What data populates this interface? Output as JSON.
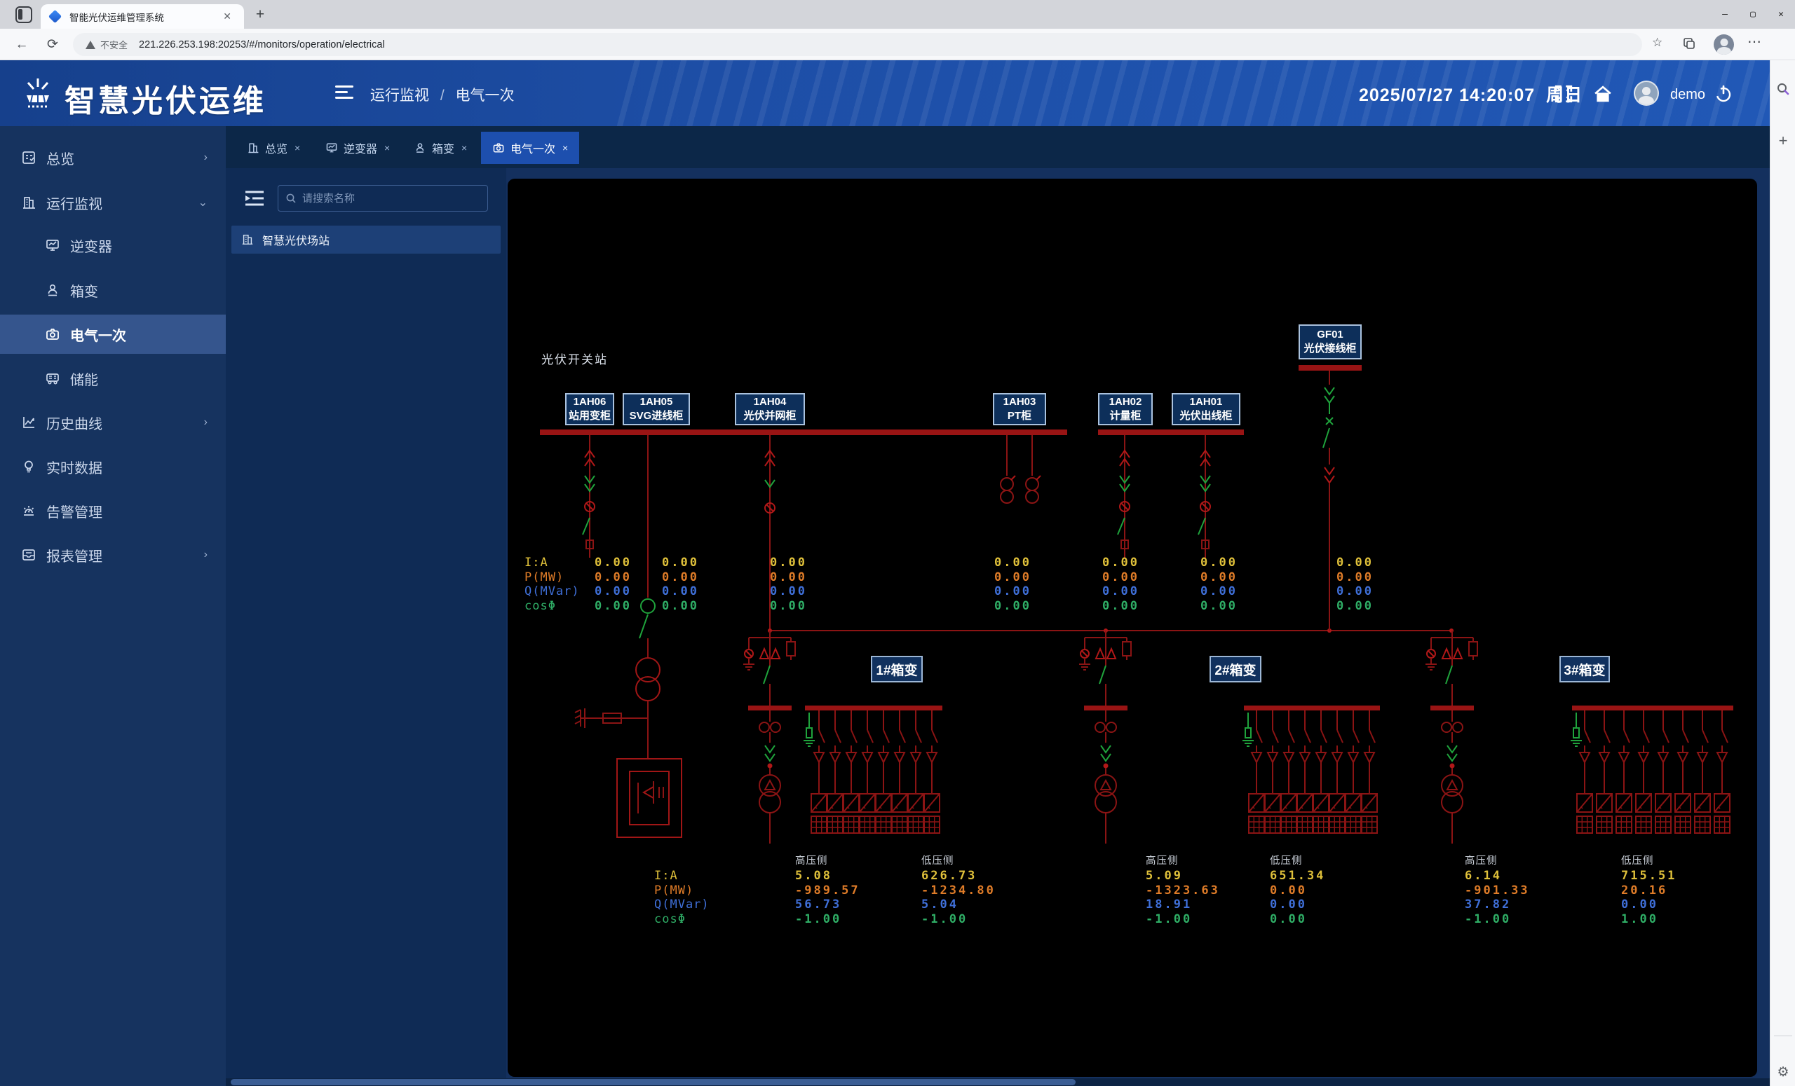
{
  "browser": {
    "tab_title": "智能光伏运维管理系统",
    "new_tab_label": "+",
    "security_label": "不安全",
    "url": "221.226.253.198:20253/#/monitors/operation/electrical",
    "window_controls": {
      "minimize": "—",
      "maximize": "▢",
      "close": "✕"
    }
  },
  "header": {
    "app_title": "智慧光伏运维",
    "breadcrumb_section": "运行监视",
    "breadcrumb_sep": "/",
    "breadcrumb_page": "电气一次",
    "datetime": "2025/07/27 14:20:07",
    "weekday": "周日",
    "username": "demo"
  },
  "sidebar": {
    "items": [
      {
        "label": "总览",
        "icon": "overview-icon",
        "chevron": "›"
      },
      {
        "label": "运行监视",
        "icon": "monitor-icon",
        "chevron": "⌄"
      },
      {
        "label": "逆变器",
        "icon": "inverter-icon"
      },
      {
        "label": "箱变",
        "icon": "box-transformer-icon"
      },
      {
        "label": "电气一次",
        "icon": "electrical-icon",
        "active": true
      },
      {
        "label": "储能",
        "icon": "storage-icon"
      },
      {
        "label": "历史曲线",
        "icon": "history-curve-icon",
        "chevron": "›"
      },
      {
        "label": "实时数据",
        "icon": "realtime-data-icon"
      },
      {
        "label": "告警管理",
        "icon": "alarm-icon"
      },
      {
        "label": "报表管理",
        "icon": "report-icon",
        "chevron": "›"
      }
    ]
  },
  "tabs": [
    {
      "label": "总览",
      "close": "×"
    },
    {
      "label": "逆变器",
      "close": "×"
    },
    {
      "label": "箱变",
      "close": "×"
    },
    {
      "label": "电气一次",
      "close": "×",
      "active": true
    }
  ],
  "tree": {
    "search_placeholder": "请搜索名称",
    "station_name": "智慧光伏场站"
  },
  "diagram": {
    "station_label": "光伏开关站",
    "cabinets": [
      {
        "code": "1AH06",
        "name": "站用变柜"
      },
      {
        "code": "1AH05",
        "name": "SVG进线柜"
      },
      {
        "code": "1AH04",
        "name": "光伏并网柜"
      },
      {
        "code": "1AH03",
        "name": "PT柜"
      },
      {
        "code": "1AH02",
        "name": "计量柜"
      },
      {
        "code": "1AH01",
        "name": "光伏出线柜"
      },
      {
        "code": "GF01",
        "name": "光伏接线柜"
      }
    ],
    "metric_labels": [
      "I:A",
      "P(MW)",
      "Q(MVar)",
      "cosΦ"
    ],
    "top_values": [
      [
        "0.00",
        "0.00",
        "0.00",
        "0.00"
      ],
      [
        "0.00",
        "0.00",
        "0.00",
        "0.00"
      ],
      [
        "0.00",
        "0.00",
        "0.00",
        "0.00"
      ],
      [
        "0.00",
        "0.00",
        "0.00",
        "0.00"
      ],
      [
        "0.00",
        "0.00",
        "0.00",
        "0.00"
      ],
      [
        "0.00",
        "0.00",
        "0.00",
        "0.00"
      ],
      [
        "0.00",
        "0.00",
        "0.00",
        "0.00"
      ]
    ],
    "hv_label": "高压侧",
    "lv_label": "低压侧",
    "transformers": [
      {
        "name": "1#箱变",
        "hv": [
          "5.08",
          "-989.57",
          "56.73",
          "-1.00"
        ],
        "lv": [
          "626.73",
          "-1234.80",
          "5.04",
          "-1.00"
        ]
      },
      {
        "name": "2#箱变",
        "hv": [
          "5.09",
          "-1323.63",
          "18.91",
          "-1.00"
        ],
        "lv": [
          "651.34",
          "0.00",
          "0.00",
          "0.00"
        ]
      },
      {
        "name": "3#箱变",
        "hv": [
          "6.14",
          "-901.33",
          "37.82",
          "-1.00"
        ],
        "lv": [
          "715.51",
          "20.16",
          "0.00",
          "1.00"
        ]
      }
    ],
    "colors": {
      "bus_red": "#991414",
      "line_red": "#8b1414",
      "accent_red": "#b01818",
      "switch_green": "#1fa33c",
      "current_yellow": "#dfc03a",
      "power_orange": "#df7c28",
      "reactive_blue": "#3f6fd8",
      "cos_green": "#2fae66"
    }
  }
}
